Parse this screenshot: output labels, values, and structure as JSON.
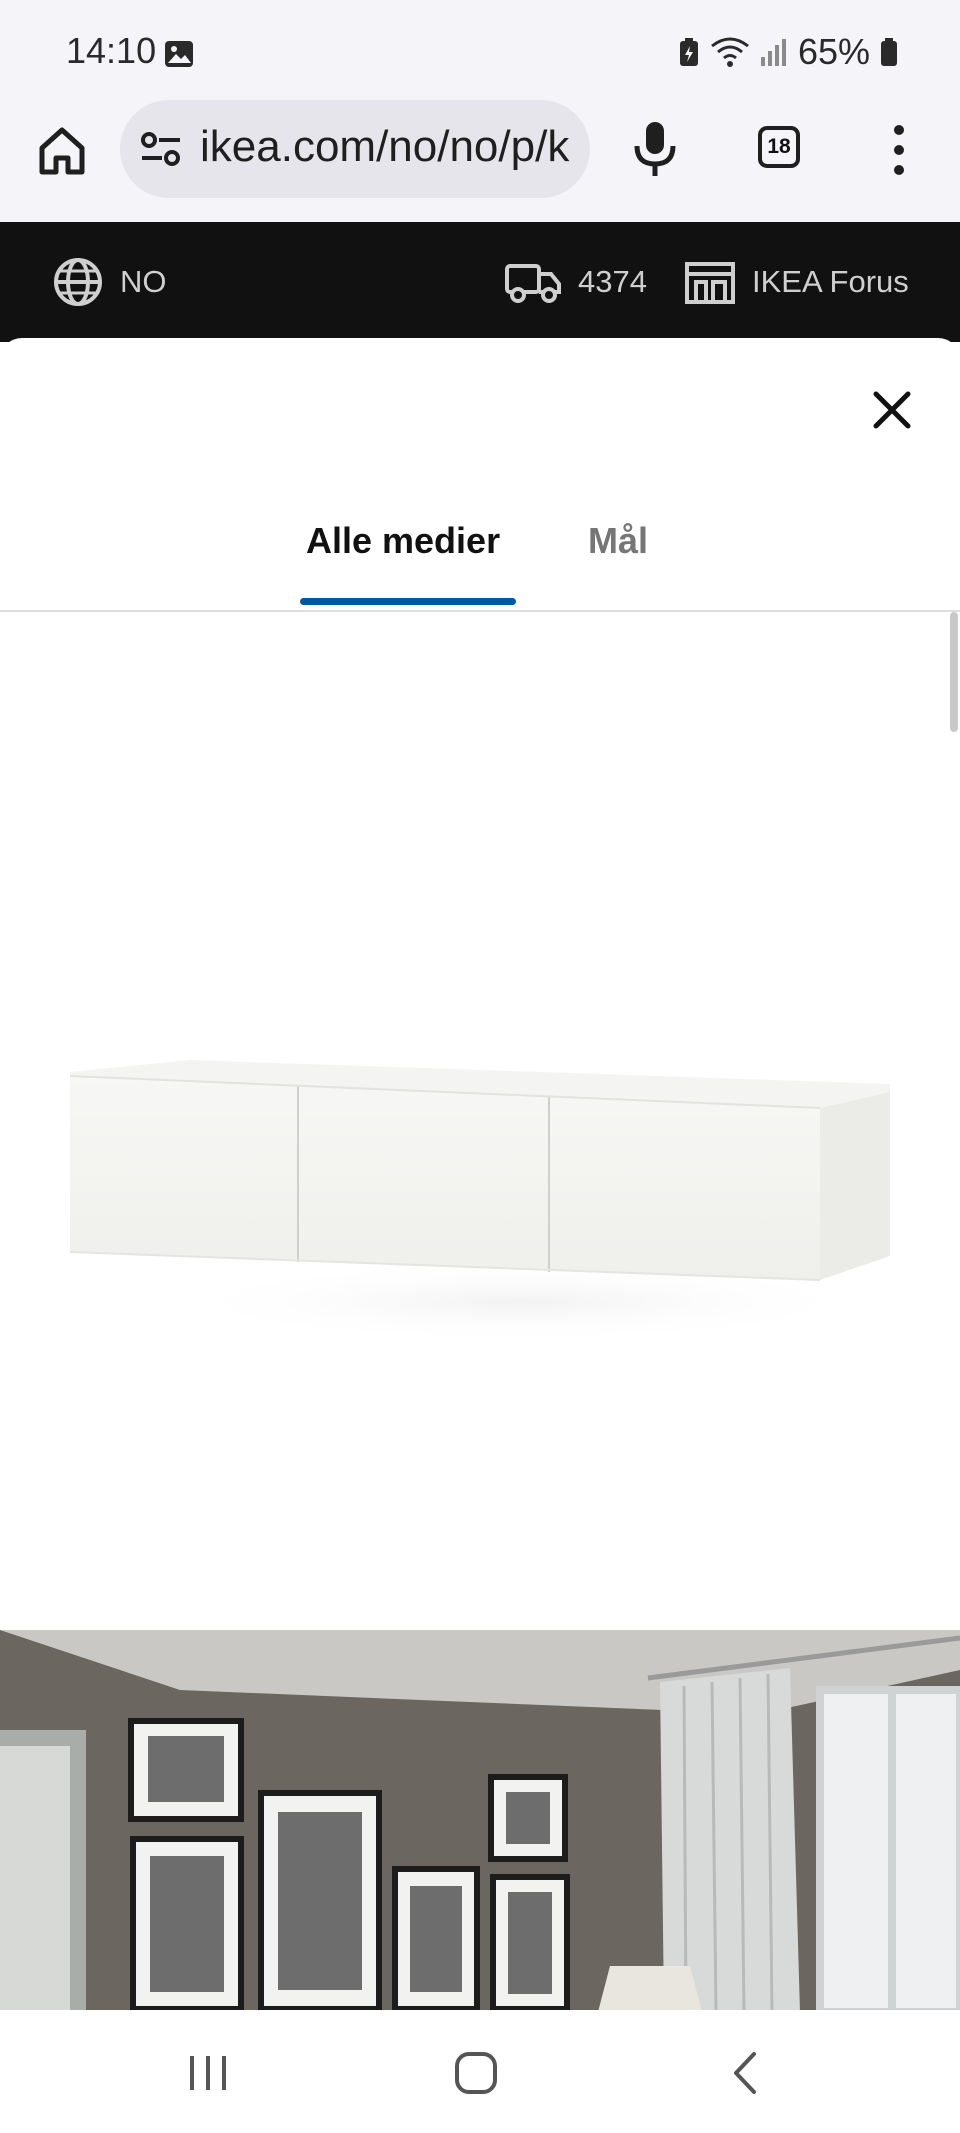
{
  "status_bar": {
    "time": "14:10",
    "battery": "65%",
    "icons": [
      "image-icon",
      "battery-saver-icon",
      "wifi-icon",
      "signal-icon",
      "battery-icon"
    ]
  },
  "browser": {
    "url": "ikea.com/no/no/p/k",
    "tab_count": "18",
    "icons": [
      "home-icon",
      "site-settings-icon",
      "microphone-icon",
      "tabs-icon",
      "more-vert-icon"
    ]
  },
  "ikea_header": {
    "language": "NO",
    "postal_code": "4374",
    "store": "IKEA Forus",
    "icons": [
      "globe-icon",
      "truck-icon",
      "store-icon"
    ]
  },
  "modal": {
    "tabs": [
      {
        "label": "Alle medier",
        "selected": true
      },
      {
        "label": "Mål",
        "selected": false
      }
    ],
    "close_icon": "close-icon",
    "accent_color": "#0058a3",
    "media": [
      "product-image-wall-cabinet",
      "room-image-living-room"
    ]
  },
  "nav_bar": {
    "icons": [
      "recents-icon",
      "home-nav-icon",
      "back-icon"
    ]
  }
}
